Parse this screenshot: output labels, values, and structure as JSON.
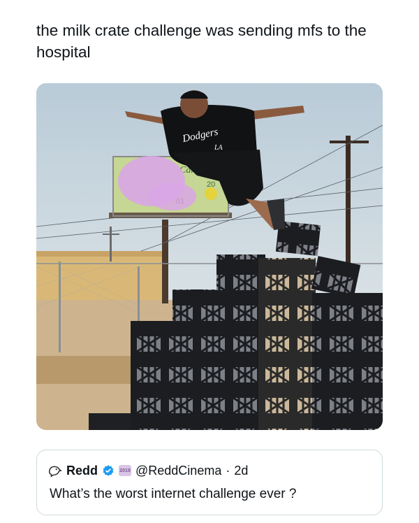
{
  "post": {
    "text": "the milk crate challenge was sending mfs to the hospital"
  },
  "media": {
    "shirt_text": "Dodgers",
    "shirt_sub": "LA",
    "billboard_line1": "Can",
    "billboard_line2": "20",
    "billboard_line3": "01"
  },
  "quote": {
    "author_name": "Redd",
    "author_handle": "@ReddCinema",
    "separator": "·",
    "time": "2d",
    "text": "What’s the worst internet challenge ever ?",
    "avatar_icon": "bird-outline-icon",
    "verified_icon": "verified-badge-icon",
    "affiliate_badge_text": "2019",
    "verified_color": "#1d9bf0"
  }
}
